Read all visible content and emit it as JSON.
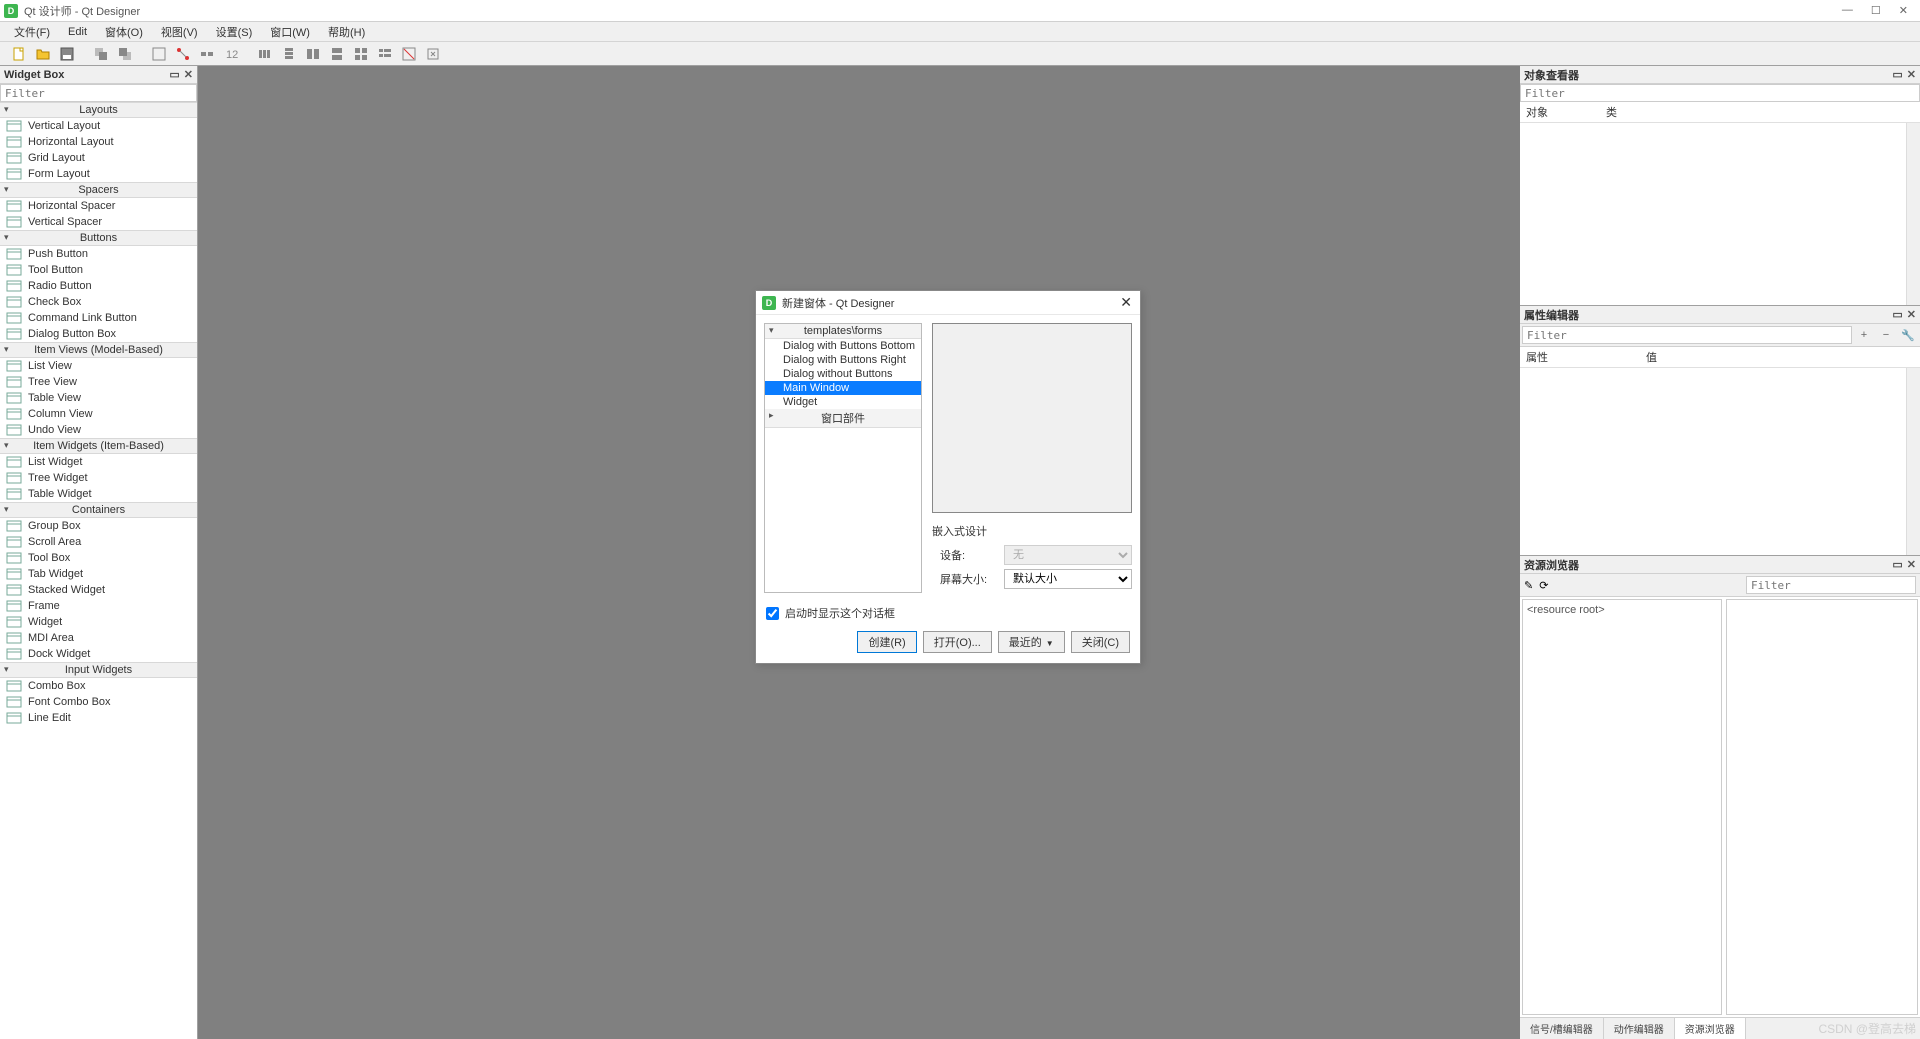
{
  "app": {
    "title": "Qt 设计师 - Qt Designer"
  },
  "menus": [
    "文件(F)",
    "Edit",
    "窗体(O)",
    "视图(V)",
    "设置(S)",
    "窗口(W)",
    "帮助(H)"
  ],
  "widget_box": {
    "title": "Widget Box",
    "filter": "Filter",
    "categories": [
      {
        "name": "Layouts",
        "items": [
          "Vertical Layout",
          "Horizontal Layout",
          "Grid Layout",
          "Form Layout"
        ]
      },
      {
        "name": "Spacers",
        "items": [
          "Horizontal Spacer",
          "Vertical Spacer"
        ]
      },
      {
        "name": "Buttons",
        "items": [
          "Push Button",
          "Tool Button",
          "Radio Button",
          "Check Box",
          "Command Link Button",
          "Dialog Button Box"
        ]
      },
      {
        "name": "Item Views (Model-Based)",
        "items": [
          "List View",
          "Tree View",
          "Table View",
          "Column View",
          "Undo View"
        ]
      },
      {
        "name": "Item Widgets (Item-Based)",
        "items": [
          "List Widget",
          "Tree Widget",
          "Table Widget"
        ]
      },
      {
        "name": "Containers",
        "items": [
          "Group Box",
          "Scroll Area",
          "Tool Box",
          "Tab Widget",
          "Stacked Widget",
          "Frame",
          "Widget",
          "MDI Area",
          "Dock Widget"
        ]
      },
      {
        "name": "Input Widgets",
        "items": [
          "Combo Box",
          "Font Combo Box",
          "Line Edit"
        ]
      }
    ]
  },
  "object_inspector": {
    "title": "对象查看器",
    "filter": "Filter",
    "col_object": "对象",
    "col_class": "类"
  },
  "property_editor": {
    "title": "属性编辑器",
    "filter": "Filter",
    "col_prop": "属性",
    "col_val": "值"
  },
  "resource_browser": {
    "title": "资源浏览器",
    "filter": "Filter",
    "root": "<resource root>",
    "tabs": [
      "信号/槽编辑器",
      "动作编辑器",
      "资源浏览器"
    ]
  },
  "dialog": {
    "title": "新建窗体 - Qt Designer",
    "tree_header": "templates\\forms",
    "items": [
      "Dialog with Buttons Bottom",
      "Dialog with Buttons Right",
      "Dialog without Buttons",
      "Main Window",
      "Widget"
    ],
    "selected_index": 3,
    "collapsed_header": "窗口部件",
    "embedded_title": "嵌入式设计",
    "device_label": "设备:",
    "device_value": "无",
    "screen_label": "屏幕大小:",
    "screen_value": "默认大小",
    "checkbox_label": "启动时显示这个对话框",
    "checkbox_checked": true,
    "buttons": {
      "create": "创建(R)",
      "open": "打开(O)...",
      "recent": "最近的",
      "close": "关闭(C)"
    }
  },
  "watermark": "CSDN @登高去梯"
}
